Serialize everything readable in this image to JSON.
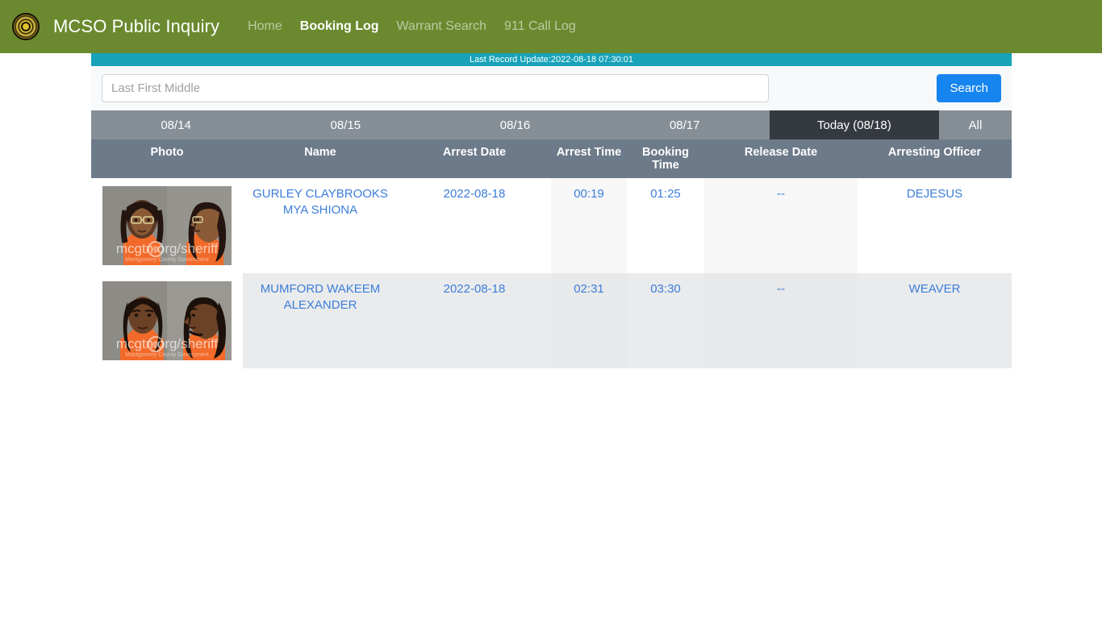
{
  "navbar": {
    "logo_icon": "sheriff-badge-icon",
    "brand": "MCSO Public Inquiry",
    "links": [
      {
        "label": "Home",
        "active": false
      },
      {
        "label": "Booking Log",
        "active": true
      },
      {
        "label": "Warrant Search",
        "active": false
      },
      {
        "label": "911 Call Log",
        "active": false
      }
    ],
    "bg_color": "#6b8a2f"
  },
  "update_bar": {
    "text": "Last Record Update:2022-08-18 07:30:01",
    "bg_color": "#17a2b8"
  },
  "search": {
    "placeholder": "Last First Middle",
    "value": "",
    "button_label": "Search",
    "button_color": "#1785ef"
  },
  "date_tabs": {
    "items": [
      {
        "label": "08/14",
        "active": false
      },
      {
        "label": "08/15",
        "active": false
      },
      {
        "label": "08/16",
        "active": false
      },
      {
        "label": "08/17",
        "active": false
      },
      {
        "label": "Today (08/18)",
        "active": true
      },
      {
        "label": "All",
        "active": false
      }
    ],
    "bg_color": "#868e96",
    "active_color": "#343a40"
  },
  "table": {
    "headers": [
      "Photo",
      "Name",
      "Arrest Date",
      "Arrest Time",
      "Booking Time",
      "Release Date",
      "Arresting Officer"
    ],
    "header_bg": "#6c7a89",
    "link_color": "#3c7dd9",
    "rows": [
      {
        "photo_alt": "mugshot-front-and-profile",
        "photo_watermark": "mcgtn.org/sheriff",
        "photo_subwatermark": "Montgomery County Government",
        "name": "GURLEY CLAYBROOKS MYA SHIONA",
        "arrest_date": "2022-08-18",
        "arrest_time": "00:19",
        "booking_time": "01:25",
        "release_date": "--",
        "arresting_officer": "DEJESUS"
      },
      {
        "photo_alt": "mugshot-front-and-profile",
        "photo_watermark": "mcgtn.org/sheriff",
        "photo_subwatermark": "Montgomery County Government",
        "name": "MUMFORD WAKEEM ALEXANDER",
        "arrest_date": "2022-08-18",
        "arrest_time": "02:31",
        "booking_time": "03:30",
        "release_date": "--",
        "arresting_officer": "WEAVER"
      }
    ]
  }
}
